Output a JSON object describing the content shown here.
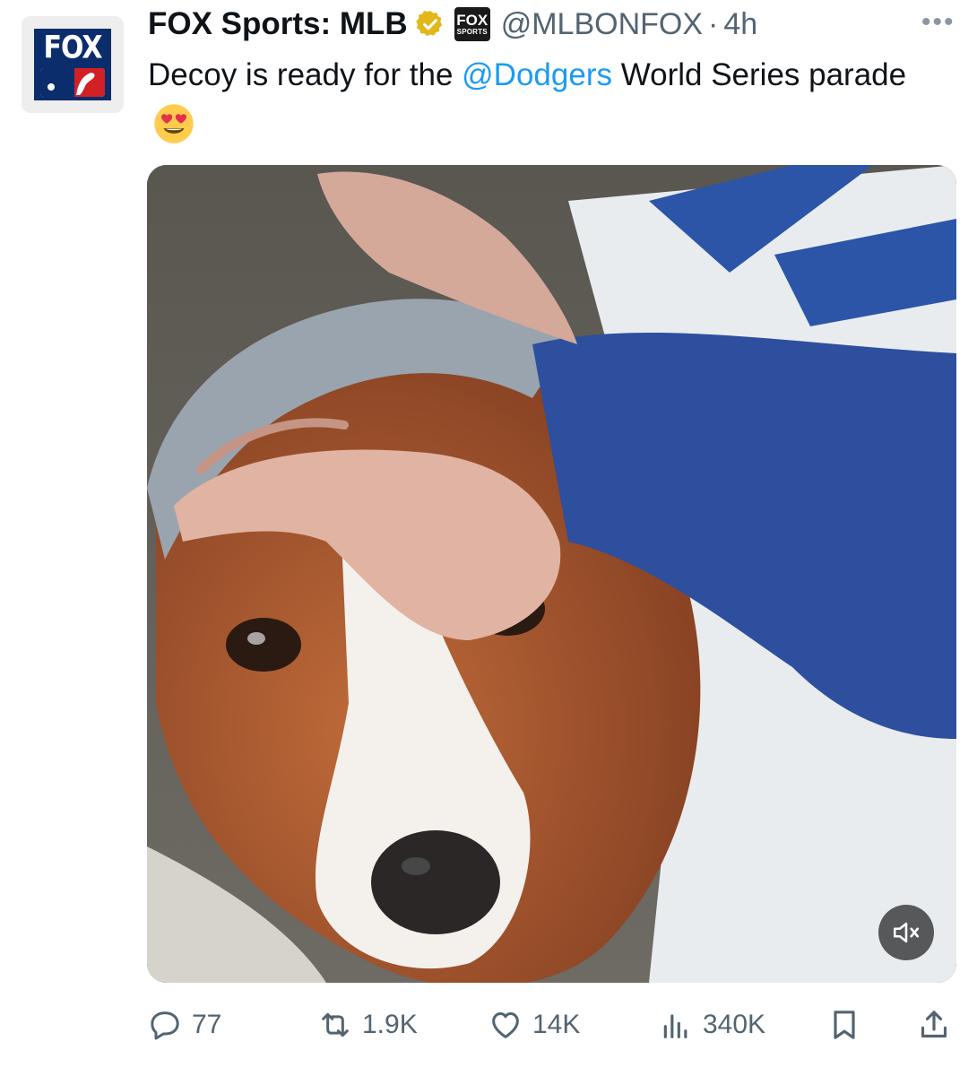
{
  "account": {
    "name": "FOX Sports: MLB",
    "handle": "@MLBONFOX",
    "separator": "·",
    "time": "4h",
    "avatar_text": "FOX",
    "badge_top": "FOX",
    "badge_bottom": "SPORTS",
    "icons": [
      "verified-gold-icon",
      "more-icon"
    ]
  },
  "tweet": {
    "text_before": "Decoy is ready for the ",
    "mention": "@Dodgers",
    "text_after": " World Series parade",
    "emoji": "heart-eyes-emoji"
  },
  "media": {
    "type": "video",
    "mute_icon": "speaker-muted-icon"
  },
  "actions": {
    "replies": "77",
    "reposts": "1.9K",
    "likes": "14K",
    "views": "340K"
  },
  "colors": {
    "link": "#1d9bf0",
    "secondary_text": "#536471",
    "verified": "#e2b719"
  }
}
